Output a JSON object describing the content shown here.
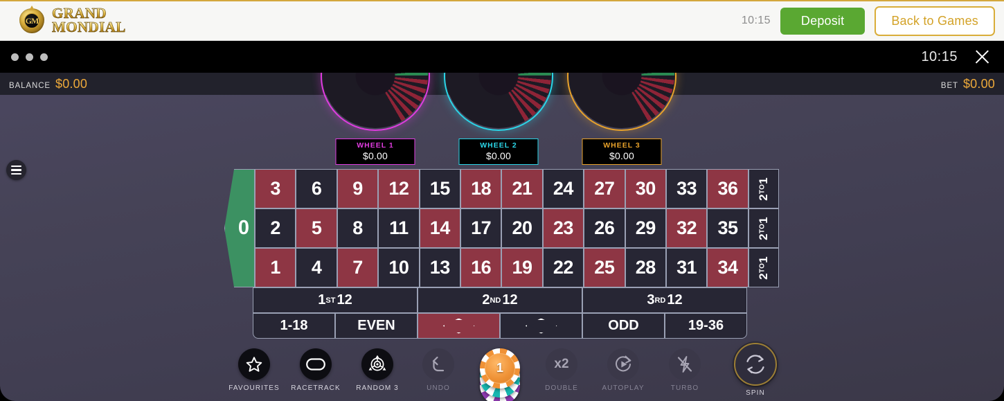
{
  "casino_bar": {
    "brand_line1": "GRAND",
    "brand_line2": "MONDIAL",
    "crest_monogram": "GM",
    "clock": "10:15",
    "deposit_label": "Deposit",
    "back_label": "Back to Games"
  },
  "game_window": {
    "clock": "10:15",
    "close_label": "✕"
  },
  "balance_bar": {
    "balance_label": "BALANCE",
    "balance_value": "$0.00",
    "bet_label": "BET",
    "bet_value": "$0.00"
  },
  "wheels": [
    {
      "name": "WHEEL 1",
      "amount": "$0.00",
      "color": "#e03ce0"
    },
    {
      "name": "WHEEL 2",
      "amount": "$0.00",
      "color": "#2bd6e8"
    },
    {
      "name": "WHEEL 3",
      "amount": "$0.00",
      "color": "#e8a22b"
    }
  ],
  "table": {
    "zero": "0",
    "rows": [
      {
        "cells": [
          {
            "n": "3",
            "c": "red"
          },
          {
            "n": "6",
            "c": "black"
          },
          {
            "n": "9",
            "c": "red"
          },
          {
            "n": "12",
            "c": "red"
          },
          {
            "n": "15",
            "c": "black"
          },
          {
            "n": "18",
            "c": "red"
          },
          {
            "n": "21",
            "c": "red"
          },
          {
            "n": "24",
            "c": "black"
          },
          {
            "n": "27",
            "c": "red"
          },
          {
            "n": "30",
            "c": "red"
          },
          {
            "n": "33",
            "c": "black"
          },
          {
            "n": "36",
            "c": "red"
          }
        ]
      },
      {
        "cells": [
          {
            "n": "2",
            "c": "black"
          },
          {
            "n": "5",
            "c": "red"
          },
          {
            "n": "8",
            "c": "black"
          },
          {
            "n": "11",
            "c": "black"
          },
          {
            "n": "14",
            "c": "red"
          },
          {
            "n": "17",
            "c": "black"
          },
          {
            "n": "20",
            "c": "black"
          },
          {
            "n": "23",
            "c": "red"
          },
          {
            "n": "26",
            "c": "black"
          },
          {
            "n": "29",
            "c": "black"
          },
          {
            "n": "32",
            "c": "red"
          },
          {
            "n": "35",
            "c": "black"
          }
        ]
      },
      {
        "cells": [
          {
            "n": "1",
            "c": "red"
          },
          {
            "n": "4",
            "c": "black"
          },
          {
            "n": "7",
            "c": "red"
          },
          {
            "n": "10",
            "c": "black"
          },
          {
            "n": "13",
            "c": "black"
          },
          {
            "n": "16",
            "c": "red"
          },
          {
            "n": "19",
            "c": "red"
          },
          {
            "n": "22",
            "c": "black"
          },
          {
            "n": "25",
            "c": "red"
          },
          {
            "n": "28",
            "c": "black"
          },
          {
            "n": "31",
            "c": "black"
          },
          {
            "n": "34",
            "c": "red"
          }
        ]
      }
    ],
    "column_bet_main": "2",
    "column_bet_sup": "TO",
    "column_bet_tail": "1",
    "dozens": [
      {
        "ord": "1",
        "sup": "ST",
        "label": "12"
      },
      {
        "ord": "2",
        "sup": "ND",
        "label": "12"
      },
      {
        "ord": "3",
        "sup": "RD",
        "label": "12"
      }
    ],
    "outside": [
      {
        "label": "1-18",
        "kind": "text"
      },
      {
        "label": "EVEN",
        "kind": "text"
      },
      {
        "label": "RED",
        "kind": "diamond-red"
      },
      {
        "label": "BLACK",
        "kind": "diamond-black"
      },
      {
        "label": "ODD",
        "kind": "text"
      },
      {
        "label": "19-36",
        "kind": "text"
      }
    ]
  },
  "toolbar": {
    "favourites": "FAVOURITES",
    "racetrack": "RACETRACK",
    "random": "RANDOM 3",
    "undo": "UNDO",
    "double": "DOUBLE",
    "autoplay": "AUTOPLAY",
    "turbo": "TURBO",
    "spin": "SPIN"
  },
  "chip": {
    "value": "1"
  },
  "colors": {
    "red_cell": "#8e3644",
    "black_cell": "#272634",
    "zero_green": "#3c9162",
    "accent_gold": "#d9ad39",
    "deposit_green": "#5aa832",
    "amount_orange": "#eda93a",
    "stage_bg": "#464357"
  }
}
